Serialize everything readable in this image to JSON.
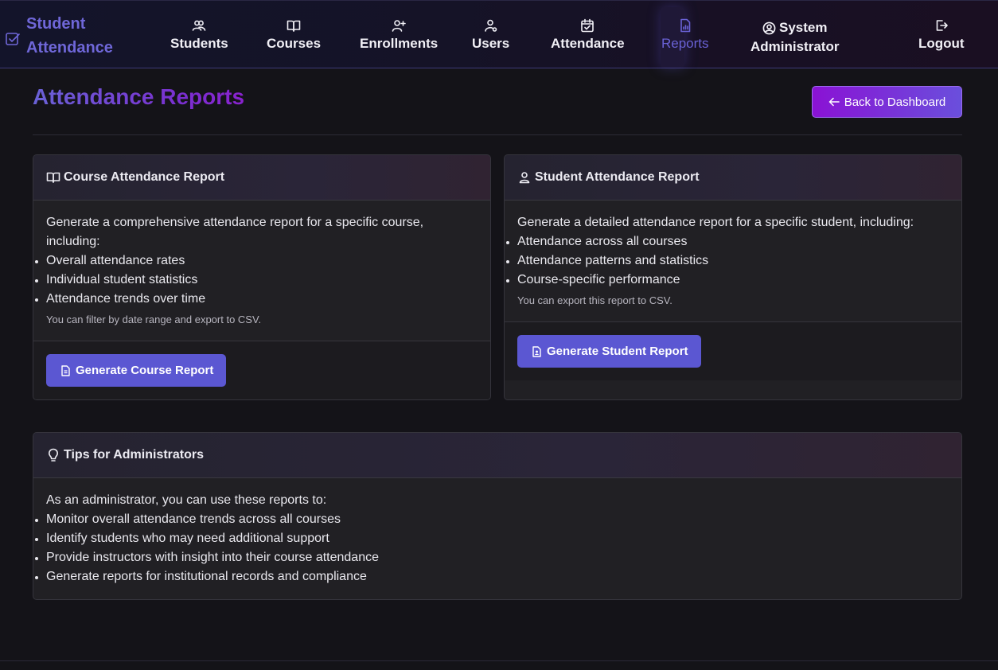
{
  "brand": {
    "line1": "Student",
    "line2": "Attendance"
  },
  "nav": {
    "students": "Students",
    "courses": "Courses",
    "enrollments": "Enrollments",
    "users": "Users",
    "attendance": "Attendance",
    "reports": "Reports",
    "user_line1": "System",
    "user_line2": "Administrator",
    "logout": "Logout"
  },
  "header": {
    "title": "Attendance Reports",
    "back_button": "Back to Dashboard"
  },
  "course_card": {
    "title": "Course Attendance Report",
    "intro": "Generate a comprehensive attendance report for a specific course, including:",
    "items": [
      "Overall attendance rates",
      "Individual student statistics",
      "Attendance trends over time"
    ],
    "note": "You can filter by date range and export to CSV.",
    "button": "Generate Course Report"
  },
  "student_card": {
    "title": "Student Attendance Report",
    "intro": "Generate a detailed attendance report for a specific student, including:",
    "items": [
      "Attendance across all courses",
      "Attendance patterns and statistics",
      "Course-specific performance"
    ],
    "note": "You can export this report to CSV.",
    "button": "Generate Student Report"
  },
  "tips_card": {
    "title": "Tips for Administrators",
    "intro": "As an administrator, you can use these reports to:",
    "items": [
      "Monitor overall attendance trends across all courses",
      "Identify students who may need additional support",
      "Provide instructors with insight into their course attendance",
      "Generate reports for institutional records and compliance"
    ]
  },
  "colors": {
    "accent": "#5b57d2",
    "brand": "#6f67d8",
    "back_button_start": "#8a12d4",
    "back_button_end": "#6a4fdc",
    "background": "#141318",
    "card": "#212024"
  },
  "icons": {
    "brand": "check-square-icon",
    "students": "users-icon",
    "courses": "book-open-icon",
    "enrollments": "user-plus-icon",
    "users": "user-gear-icon",
    "attendance": "calendar-check-icon",
    "reports": "bar-chart-icon",
    "user": "user-circle-icon",
    "logout": "logout-icon",
    "back": "arrow-left-icon",
    "report_button": "file-report-icon",
    "tips": "lightbulb-icon"
  }
}
